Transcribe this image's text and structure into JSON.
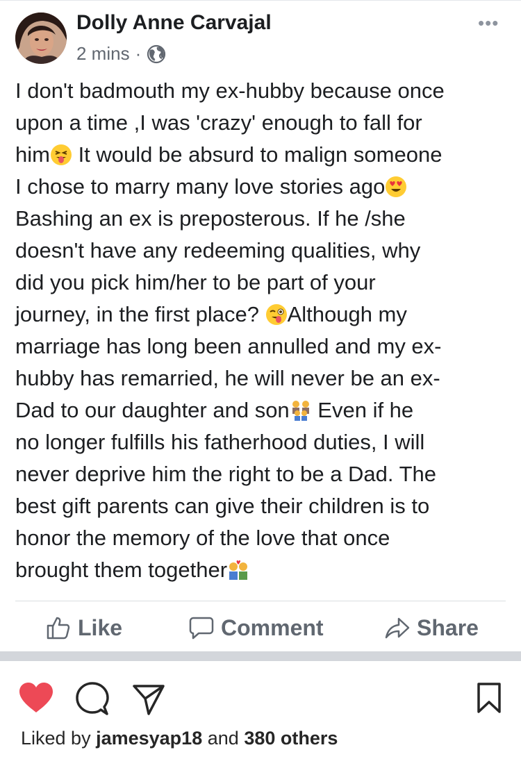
{
  "post": {
    "author": "Dolly Anne Carvajal",
    "time": "2 mins",
    "separator": "·",
    "more": "•••",
    "lines": [
      {
        "text": "I  don't badmouth my ex-hubby because once",
        "emoji": ""
      },
      {
        "text": "upon a time ,I was 'crazy' enough to fall for",
        "emoji": ""
      },
      {
        "text": "him",
        "emoji": "tongue-squint",
        "after": " It would be absurd to malign someone"
      },
      {
        "text": "I chose to marry  many love stories ago",
        "emoji": "heart-eyes",
        "after": ""
      },
      {
        "text": "Bashing an ex is preposterous. If he /she",
        "emoji": ""
      },
      {
        "text": "doesn't have any redeeming qualities, why",
        "emoji": ""
      },
      {
        "text": "did you pick him/her to be part of your",
        "emoji": ""
      },
      {
        "text": "journey, in the first place? ",
        "emoji": "wink-tongue",
        "after": "Although my"
      },
      {
        "text": "marriage has long been annulled and my ex-",
        "emoji": ""
      },
      {
        "text": "hubby has remarried, he will never be an ex-",
        "emoji": ""
      },
      {
        "text": "Dad to our daughter and son",
        "emoji": "family",
        "after": " Even if    he"
      },
      {
        "text": "no longer fulfills his fatherhood duties, I will",
        "emoji": ""
      },
      {
        "text": "never deprive him the right to be a Dad. The",
        "emoji": ""
      },
      {
        "text": "best gift parents can give their children is to",
        "emoji": ""
      },
      {
        "text": "honor the memory of the love that once",
        "emoji": ""
      },
      {
        "text": "brought them together",
        "emoji": "kiss-couple",
        "after": ""
      }
    ]
  },
  "actions": {
    "like": "Like",
    "comment": "Comment",
    "share": "Share"
  },
  "instagram": {
    "liked_prefix": "Liked by",
    "liked_user": "jamesyap18",
    "liked_and": "and",
    "liked_others": "380 others",
    "heart_color": "#ed4956",
    "icons": [
      "heart-icon",
      "comment-icon",
      "direct-share-icon",
      "bookmark-icon"
    ]
  },
  "colors": {
    "text": "#1c1e21",
    "meta": "#616770",
    "action": "#606770",
    "band": "#d3d6db"
  }
}
